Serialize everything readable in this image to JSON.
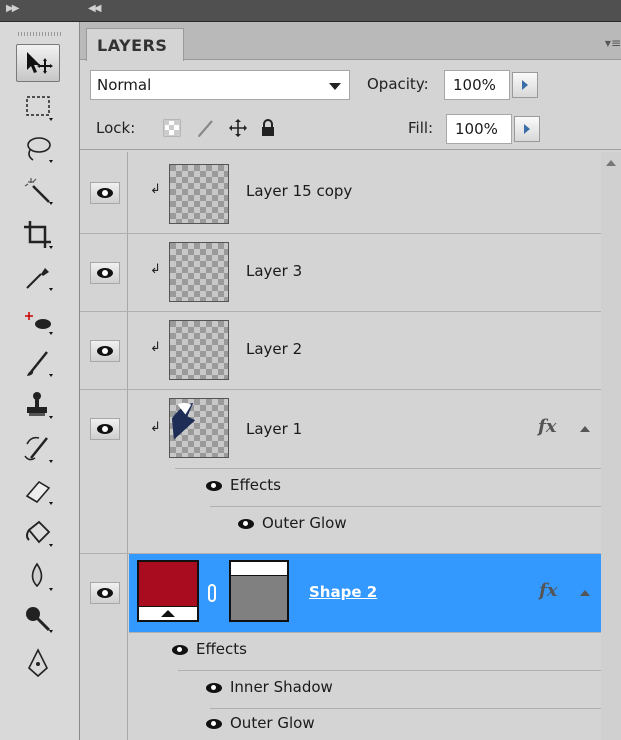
{
  "toolbox": {
    "tools": [
      "move-tool",
      "marquee-tool",
      "lasso-tool",
      "magic-wand-tool",
      "crop-tool",
      "eyedropper-tool",
      "spot-healing-tool",
      "brush-tool",
      "clone-stamp-tool",
      "history-brush-tool",
      "eraser-tool",
      "paint-bucket-tool",
      "blur-tool",
      "dodge-tool",
      "pen-tool"
    ]
  },
  "panel": {
    "tab_label": "LAYERS",
    "blend_mode": "Normal",
    "opacity_label": "Opacity:",
    "opacity_value": "100%",
    "lock_label": "Lock:",
    "fill_label": "Fill:",
    "fill_value": "100%"
  },
  "layers": [
    {
      "name": "Layer 15 copy",
      "visible": true,
      "clipped": true
    },
    {
      "name": "Layer 3",
      "visible": true,
      "clipped": true
    },
    {
      "name": "Layer 2",
      "visible": true,
      "clipped": true
    },
    {
      "name": "Layer 1",
      "visible": true,
      "clipped": true,
      "fx": "fx",
      "effects_label": "Effects",
      "effects": [
        "Outer Glow"
      ]
    },
    {
      "name": "Shape 2",
      "visible": true,
      "selected": true,
      "fx": "fx",
      "effects_label": "Effects",
      "effects": [
        "Inner Shadow",
        "Outer Glow"
      ]
    }
  ],
  "colors": {
    "selection": "#3399ff",
    "shape_fill": "#a90b1f"
  }
}
